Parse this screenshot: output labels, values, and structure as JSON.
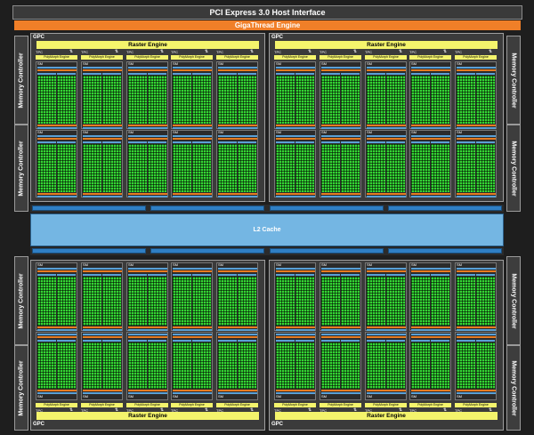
{
  "header": {
    "host_interface": "PCI Express 3.0 Host Interface",
    "giga_engine": "GigaThread Engine"
  },
  "memory_controller_label": "Memory Controller",
  "l2_cache_label": "L2 Cache",
  "gpc": {
    "label": "GPC",
    "raster_label": "Raster Engine",
    "tpc_label": "TPC",
    "polymorph_label": "PolyMorph Engine",
    "sm_label": "SM",
    "tpc_count": 5,
    "sm_per_tpc": 2
  },
  "colors": {
    "giga": "#f07f28",
    "raster": "#f4f46c",
    "l2": "#74b6e3",
    "cores": "#34d534"
  }
}
